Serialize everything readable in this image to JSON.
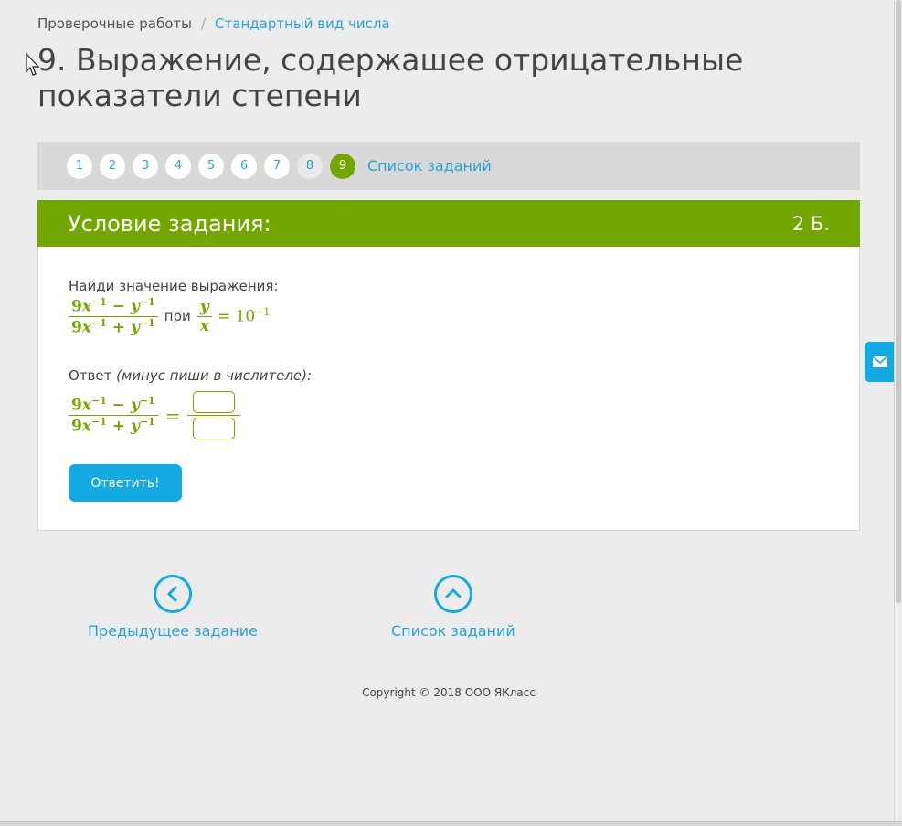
{
  "breadcrumb": {
    "root": "Проверочные работы",
    "separator": "/",
    "current": "Стандартный вид числа"
  },
  "page_title": "9. Выражение, содержашее отрицательные показатели степени",
  "task_nav": {
    "numbers": [
      "1",
      "2",
      "3",
      "4",
      "5",
      "6",
      "7",
      "8",
      "9"
    ],
    "active": "9",
    "list_link": "Список заданий"
  },
  "task": {
    "header_title": "Условие задания:",
    "points": "2 Б.",
    "prompt": "Найди значение выражения:",
    "condition_word": "при",
    "answer_label": "Ответ",
    "answer_hint": "(минус пиши в числителе):",
    "submit_label": "Ответить!"
  },
  "bottom_nav": {
    "prev_label": "Предыдущее задание",
    "list_label": "Список заданий"
  },
  "footer": {
    "copyright": "Copyright © 2018 ООО ЯКласс"
  },
  "colors": {
    "accent_green": "#72a700",
    "accent_blue": "#14a9e0",
    "link_blue": "#2aa2d6"
  }
}
